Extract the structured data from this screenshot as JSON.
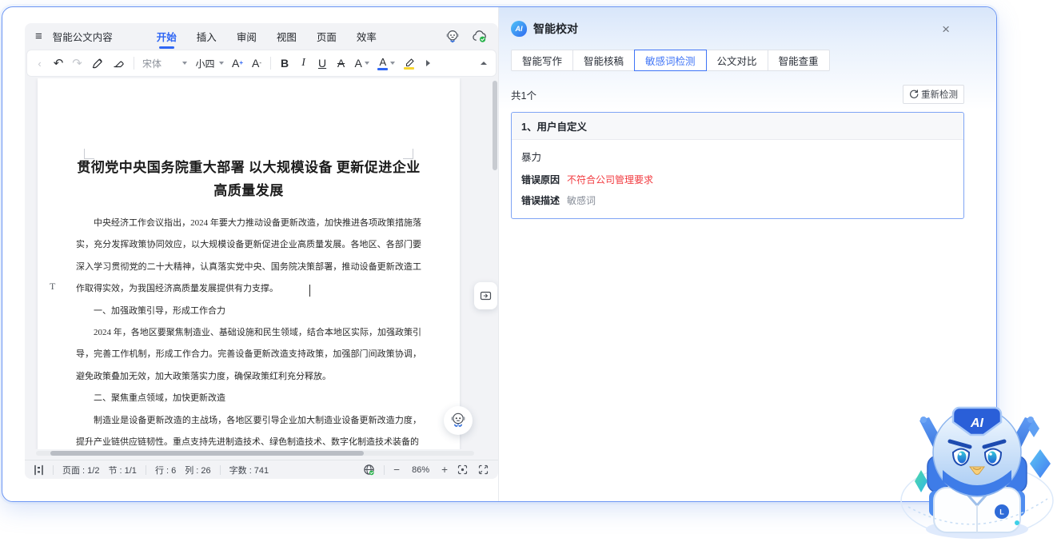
{
  "colors": {
    "accent": "#2f66f4",
    "error_red": "#f23a3f",
    "card_border": "#7fa4f4"
  },
  "editor": {
    "menu": {
      "hamburger_icon": "≡",
      "title": "智能公文内容",
      "tabs": [
        {
          "label": "开始"
        },
        {
          "label": "插入"
        },
        {
          "label": "审阅"
        },
        {
          "label": "视图"
        },
        {
          "label": "页面"
        },
        {
          "label": "效率"
        }
      ]
    },
    "toolbar": {
      "back_icon": "‹",
      "undo_icon": "↶",
      "redo_icon": "↷",
      "font_name": "宋体",
      "font_size": "小四",
      "size_up_letter": "A",
      "size_up_mark": "+",
      "size_down_letter": "A",
      "size_down_mark": "-",
      "bold": "B",
      "italic": "I",
      "underline": "U",
      "strike_letter": "A",
      "effects_letter": "A",
      "color_letter": "A"
    },
    "document": {
      "title": "贯彻党中央国务院重大部署  以大规模设备  更新促进企业高质量发展",
      "margin_marker": "T",
      "paragraphs": [
        "中央经济工作会议指出，2024 年要大力推动设备更新改造，加快推进各项政策措施落实，充分发挥政策协同效应，以大规模设备更新促进企业高质量发展。各地区、各部门要深入学习贯彻党的二十大精神，认真落实党中央、国务院决策部署，推动设备更新改造工作取得实效，为我国经济高质量发展提供有力支撑。",
        "一、加强政策引导，形成工作合力",
        "2024 年，各地区要聚焦制造业、基础设施和民生领域，结合本地区实际，加强政策引导，完善工作机制，形成工作合力。完善设备更新改造支持政策，加强部门间政策协调，避免政策叠加无效，加大政策落实力度，确保政策红利充分释放。",
        "二、聚焦重点领域，加快更新改造",
        "制造业是设备更新改造的主战场，各地区要引导企业加大制造业设备更新改造力度，提升产业链供应链韧性。重点支持先进制造技术、绿色制造技术、数字化制造技术装备的"
      ]
    },
    "statusbar": {
      "page": "页面 : 1/2",
      "section": "节 : 1/1",
      "line": "行 : 6",
      "column": "列 : 26",
      "words": "字数 : 741",
      "zoom_out": "−",
      "zoom": "86%",
      "zoom_in": "+"
    }
  },
  "panel": {
    "ai_badge": "AI",
    "title": "智能校对",
    "close_icon": "×",
    "tabs": [
      {
        "label": "智能写作"
      },
      {
        "label": "智能核稿"
      },
      {
        "label": "敏感词检测"
      },
      {
        "label": "公文对比"
      },
      {
        "label": "智能查重"
      }
    ],
    "active_tab": "敏感词检测",
    "count": "共1个",
    "recheck_label": "重新检测",
    "card": {
      "index": "1、",
      "category": "用户自定义",
      "term": "暴力",
      "reason_label": "错误原因",
      "reason": "不符合公司管理要求",
      "desc_label": "错误描述",
      "desc": "敏感词"
    }
  },
  "mascot": {
    "badge": "AI",
    "chest": "L"
  }
}
